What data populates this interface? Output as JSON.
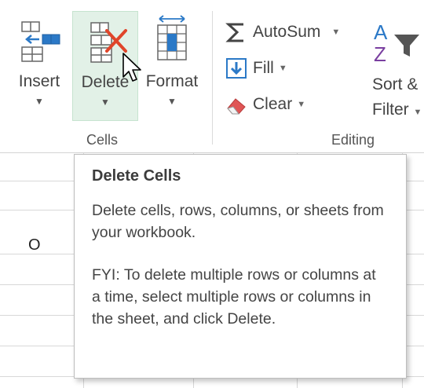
{
  "ribbon": {
    "cells_group": {
      "label": "Cells",
      "insert": {
        "label": "Insert",
        "icon": "insert-cells-icon"
      },
      "delete": {
        "label": "Delete",
        "icon": "delete-cells-icon",
        "state": "hover",
        "highlight_color": "#e2f1e7"
      },
      "format": {
        "label": "Format",
        "icon": "format-cells-icon"
      }
    },
    "editing_group": {
      "label": "Editing",
      "autosum": {
        "label": "AutoSum",
        "icon": "sigma-icon"
      },
      "fill": {
        "label": "Fill",
        "icon": "fill-down-icon"
      },
      "clear": {
        "label": "Clear",
        "icon": "eraser-icon"
      },
      "sort_filter": {
        "line1": "Sort &",
        "line2": "Filter",
        "icon": "sort-filter-icon"
      }
    }
  },
  "sheet": {
    "visible_cell_text": "O"
  },
  "tooltip": {
    "title": "Delete Cells",
    "description": "Delete cells, rows, columns, or sheets from your workbook.",
    "fyi": "FYI: To delete multiple rows or columns at a time, select multiple rows or columns in the sheet, and click Delete."
  },
  "colors": {
    "accent_blue": "#2b79c7",
    "delete_red": "#e0452a",
    "hover_bg": "#e2f1e7"
  }
}
